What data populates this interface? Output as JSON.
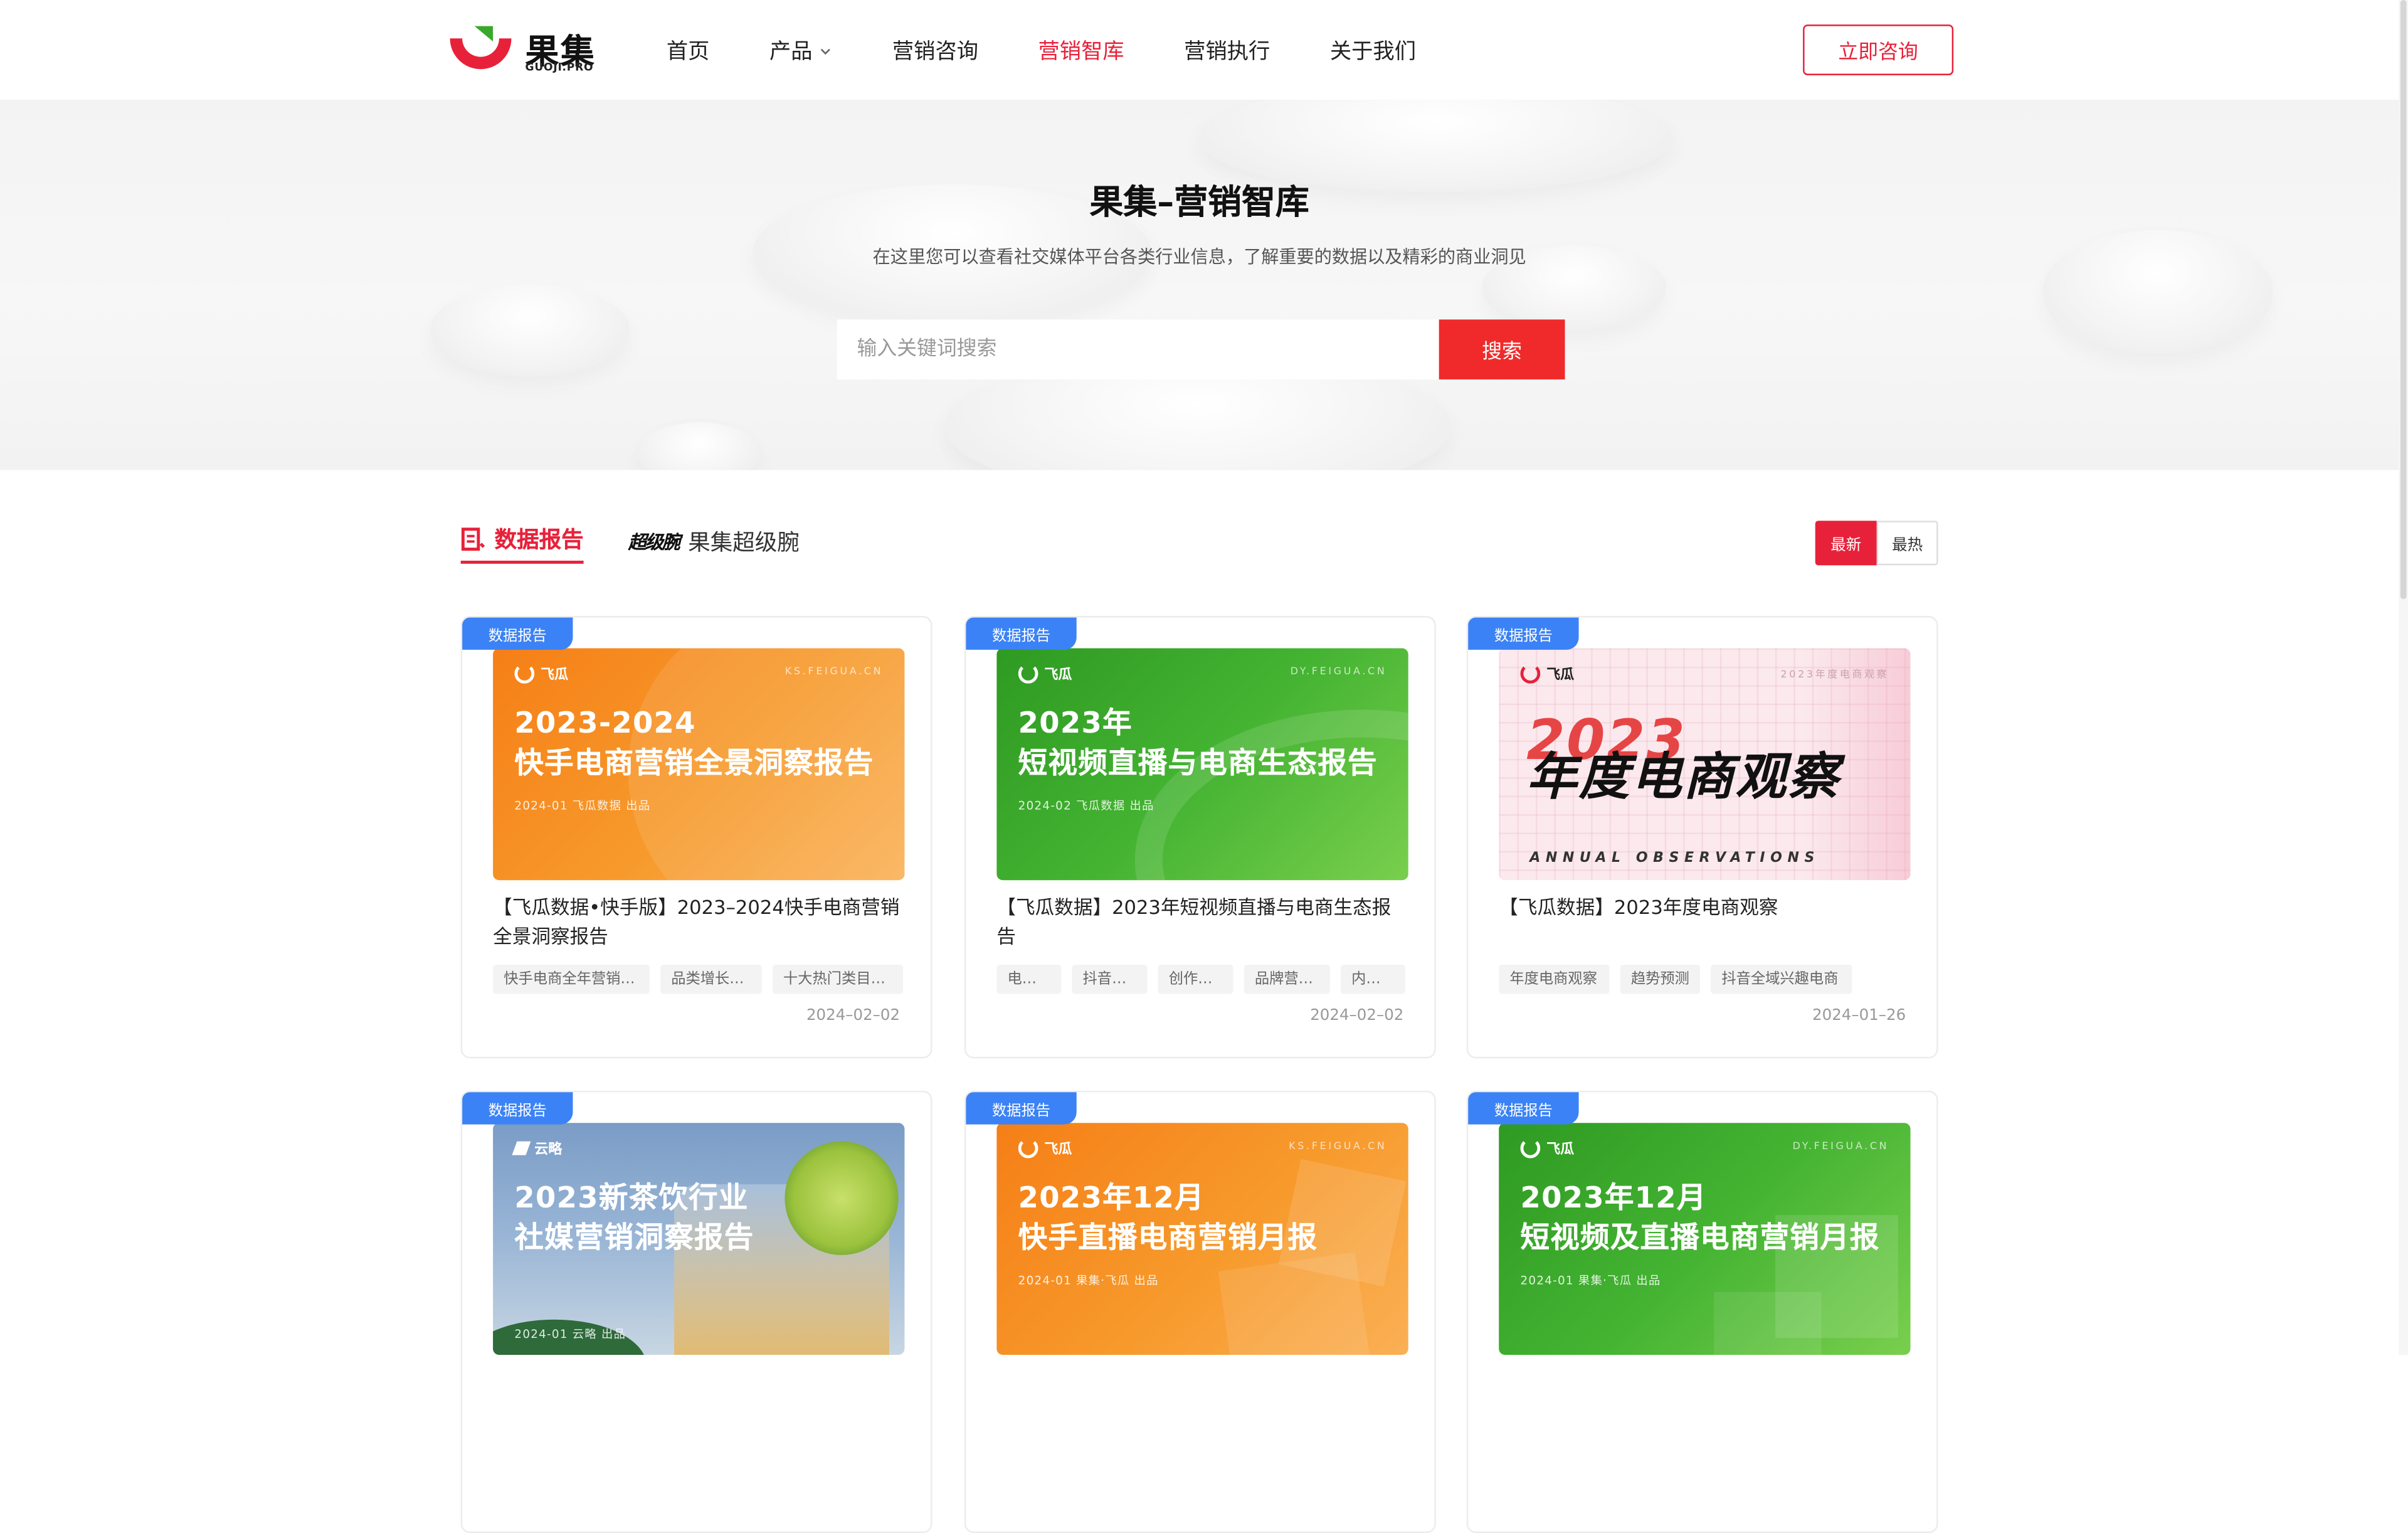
{
  "logo": {
    "cn": "果集",
    "en": "GUOJI.PRO"
  },
  "nav": {
    "items": [
      {
        "label": "首页"
      },
      {
        "label": "产品"
      },
      {
        "label": "营销咨询"
      },
      {
        "label": "营销智库"
      },
      {
        "label": "营销执行"
      },
      {
        "label": "关于我们"
      }
    ],
    "consult_label": "立即咨询"
  },
  "hero": {
    "title": "果集–营销智库",
    "subtitle": "在这里您可以查看社交媒体平台各类行业信息，了解重要的数据以及精彩的商业洞见",
    "search_placeholder": "输入关键词搜索",
    "search_button": "搜索"
  },
  "tabs": {
    "reports": "数据报告",
    "super_mark": "超级腕",
    "super": "果集超级腕"
  },
  "sort": {
    "newest": "最新",
    "hottest": "最热"
  },
  "colors": {
    "accent": "#e8213a",
    "badge": "#3b82f6",
    "orange": "#f58a1f",
    "green": "#3aa82c"
  },
  "cards": [
    {
      "badge": "数据报告",
      "cover": {
        "brand": "飞瓜",
        "domain": "KS.FEIGUA.CN",
        "line1": "2023-2024",
        "line2": "快手电商营销全景洞察报告",
        "meta": "2024-01 飞瓜数据 出品"
      },
      "title": "【飞瓜数据•快手版】2023–2024快手电商营销全景洞察报告",
      "tags": [
        "快手电商全年营销…",
        "品类增长…",
        "十大热门类目…"
      ],
      "date": "2024–02–02"
    },
    {
      "badge": "数据报告",
      "cover": {
        "brand": "飞瓜",
        "domain": "DY.FEIGUA.CN",
        "line1": "2023年",
        "line2": "短视频直播与电商生态报告",
        "meta": "2024-02 飞瓜数据 出品"
      },
      "title": "【飞瓜数据】2023年短视频直播与电商生态报告",
      "tags": [
        "电…",
        "抖音…",
        "创作…",
        "品牌营…",
        "内…"
      ],
      "date": "2024–02–02"
    },
    {
      "badge": "数据报告",
      "cover": {
        "brand": "飞瓜",
        "domain": "2023年度电商观察",
        "line1": "2023",
        "line2": "年度电商观察",
        "meta": "ANNUAL OBSERVATIONS"
      },
      "title": "【飞瓜数据】2023年度电商观察",
      "tags": [
        "年度电商观察",
        "趋势预测",
        "抖音全域兴趣电商"
      ],
      "date": "2024–01–26"
    },
    {
      "badge": "数据报告",
      "cover": {
        "brand": "云略",
        "domain": "",
        "line1": "2023新茶饮行业",
        "line2": "社媒营销洞察报告",
        "meta": "2024-01 云略 出品"
      },
      "title": "",
      "tags": [],
      "date": ""
    },
    {
      "badge": "数据报告",
      "cover": {
        "brand": "飞瓜",
        "domain": "KS.FEIGUA.CN",
        "line1": "2023年12月",
        "line2": "快手直播电商营销月报",
        "meta": "2024-01 果集·飞瓜 出品"
      },
      "title": "",
      "tags": [],
      "date": ""
    },
    {
      "badge": "数据报告",
      "cover": {
        "brand": "飞瓜",
        "domain": "DY.FEIGUA.CN",
        "line1": "2023年12月",
        "line2": "短视频及直播电商营销月报",
        "meta": "2024-01 果集·飞瓜 出品"
      },
      "title": "",
      "tags": [],
      "date": ""
    }
  ]
}
